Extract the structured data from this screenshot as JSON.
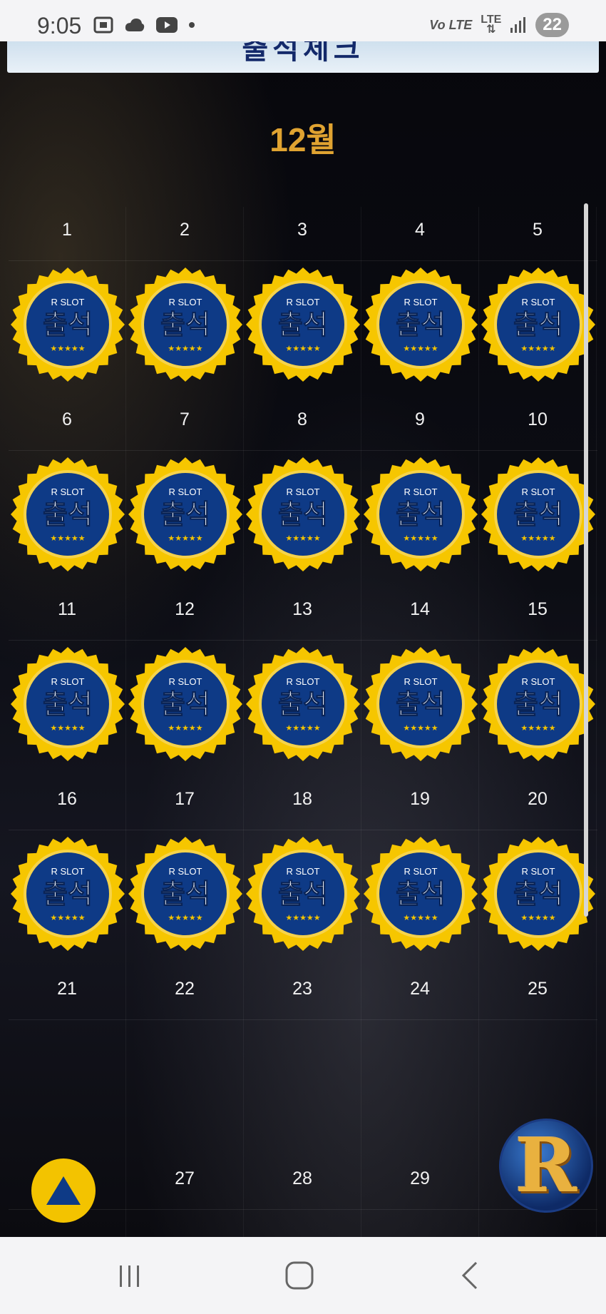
{
  "status_bar": {
    "time": "9:05",
    "network_label": "Vo LTE",
    "lte_label": "LTE",
    "battery": "22",
    "icons_left": [
      "screenshot-icon",
      "cloud-icon",
      "youtube-icon",
      "dot-icon"
    ],
    "icons_right": [
      "volte-icon",
      "lte-icon",
      "signal-icon",
      "battery-icon"
    ]
  },
  "banner": {
    "partial_title": "출석체크"
  },
  "calendar": {
    "month_label": "12월",
    "badge": {
      "brand": "R SLOT",
      "label": "출석",
      "stars": "★★★★★"
    },
    "weeks": [
      {
        "days": [
          "1",
          "2",
          "3",
          "4",
          "5"
        ],
        "checked": [
          true,
          true,
          true,
          true,
          true
        ]
      },
      {
        "days": [
          "6",
          "7",
          "8",
          "9",
          "10"
        ],
        "checked": [
          true,
          true,
          true,
          true,
          true
        ]
      },
      {
        "days": [
          "11",
          "12",
          "13",
          "14",
          "15"
        ],
        "checked": [
          true,
          true,
          true,
          true,
          true
        ]
      },
      {
        "days": [
          "16",
          "17",
          "18",
          "19",
          "20"
        ],
        "checked": [
          true,
          true,
          true,
          true,
          true
        ]
      },
      {
        "days": [
          "21",
          "22",
          "23",
          "24",
          "25"
        ],
        "checked": [
          false,
          false,
          false,
          false,
          false
        ]
      },
      {
        "days": [
          "",
          "27",
          "28",
          "29",
          ""
        ],
        "checked": [
          false,
          false,
          false,
          false,
          false
        ]
      }
    ]
  },
  "floating": {
    "logo_letter": "R"
  },
  "colors": {
    "accent_gold": "#e0a331",
    "badge_blue": "#0e3a86",
    "badge_gold": "#f3c300"
  },
  "nav_bar": {
    "buttons": [
      "recents-button",
      "home-button",
      "back-button"
    ]
  }
}
